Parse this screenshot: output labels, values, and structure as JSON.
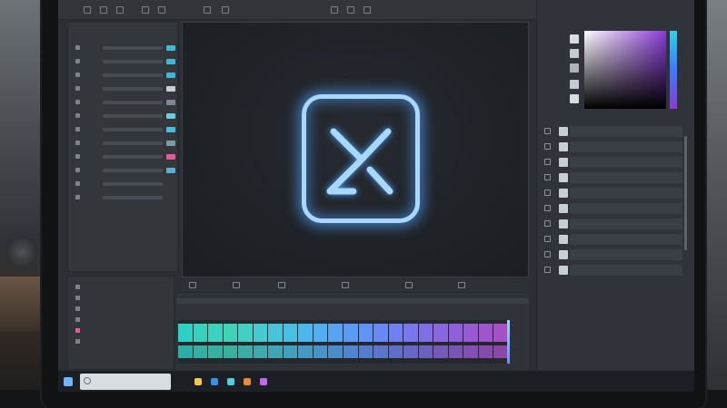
{
  "app": {
    "canvas_tab_label": "",
    "accent_color": "#8fc4ff"
  },
  "toolbar": {
    "icons": [
      "new-icon",
      "open-icon",
      "save-icon",
      "undo-icon",
      "redo-icon",
      "crop-icon",
      "text-icon",
      "brush-icon",
      "select-icon",
      "zoom-icon",
      "settings-icon"
    ]
  },
  "left_panel": {
    "title": "",
    "rows": [
      {
        "icon": "layer-icon"
      },
      {
        "icon": "layer-icon"
      },
      {
        "icon": "layer-icon"
      },
      {
        "icon": "layer-icon"
      },
      {
        "icon": "layer-icon"
      },
      {
        "icon": "layer-icon"
      },
      {
        "icon": "layer-icon"
      },
      {
        "icon": "layer-icon"
      },
      {
        "icon": "layer-icon"
      },
      {
        "icon": "layer-icon"
      },
      {
        "icon": "layer-icon"
      },
      {
        "icon": "layer-icon"
      }
    ],
    "swatch_colors": [
      "#3fb8d6",
      "#3fb8d6",
      "#3fb8d6",
      "#c9ced3",
      "#7f8892",
      "#6ecbe0",
      "#46c0e0",
      "#7b9aa8",
      "#e05a9c",
      "#5ab0d8"
    ]
  },
  "canvas": {
    "logo_icon": "x-logo-icon",
    "logo_glow_color": "#a9d8ff"
  },
  "timeline": {
    "track_colors": [
      "#2fd0c4",
      "#36d2c0",
      "#3ad3bd",
      "#3ed3b8",
      "#41cfc6",
      "#43cbd0",
      "#46c5da",
      "#49bfe2",
      "#4cb7ea",
      "#4faff0",
      "#55a5f4",
      "#5b9bf6",
      "#6192f6",
      "#6889f4",
      "#7080f0",
      "#7877ec",
      "#806fe6",
      "#8867e0",
      "#9060da",
      "#985ad4",
      "#9f55ce",
      "#a650c8"
    ],
    "playhead_color": "#9bd3ff"
  },
  "right_panel": {
    "picker_hue_top": "#2fd2e6",
    "picker_hue_bottom": "#8a3bd6",
    "rows": [
      {
        "icon": "folder-icon"
      },
      {
        "icon": "folder-icon"
      },
      {
        "icon": "image-icon"
      },
      {
        "icon": "image-icon"
      },
      {
        "icon": "image-icon"
      },
      {
        "icon": "image-icon"
      },
      {
        "icon": "image-icon"
      },
      {
        "icon": "image-icon"
      },
      {
        "icon": "image-icon"
      },
      {
        "icon": "image-icon"
      }
    ]
  },
  "taskbar": {
    "search_placeholder": "",
    "apps": [
      {
        "name": "file-explorer-icon",
        "color": "#f0c84a"
      },
      {
        "name": "browser-icon",
        "color": "#3a8fe8"
      },
      {
        "name": "mail-icon",
        "color": "#4ad0e0"
      },
      {
        "name": "store-icon",
        "color": "#e88a3a"
      },
      {
        "name": "creative-app-icon",
        "color": "#c06ae8"
      }
    ]
  }
}
